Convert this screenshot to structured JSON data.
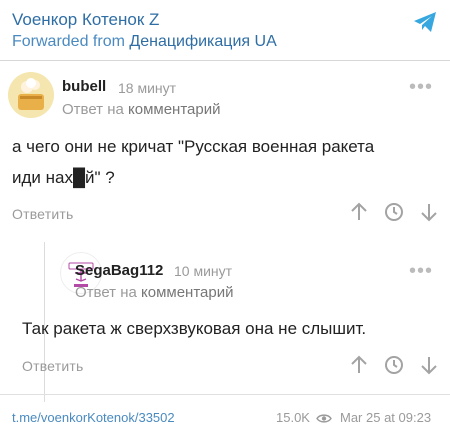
{
  "header": {
    "channel_title": "Voенкор Котенок Z",
    "forwarded_prefix": "Forwarded from ",
    "forwarded_source": "Денацификация UA"
  },
  "comment1": {
    "username": "bubell",
    "time": "18 минут",
    "reply_prefix": "Ответ на ",
    "reply_target": "комментарий",
    "text_line1": "а чего они не кричат \"Русская военная ракета",
    "text_line2": "иди нах█й\" ?",
    "answer_label": "Ответить"
  },
  "comment2": {
    "username": "SegaBag112",
    "time": "10 минут",
    "reply_prefix": "Ответ на ",
    "reply_target": "комментарий",
    "text": "Так ракета ж сверхзвуковая она не слышит.",
    "answer_label": "Ответить"
  },
  "footer": {
    "link": "t.me/voenkorKotenok/33502",
    "views": "15.0K",
    "date": "Mar 25 at 09:23"
  },
  "icons": {
    "telegram": "telegram-plane-icon",
    "more": "more-dots-icon",
    "upvote": "arrow-up-icon",
    "clock": "clock-icon",
    "downvote": "arrow-down-icon",
    "views": "eye-icon"
  },
  "colors": {
    "link_blue": "#2f6ea5",
    "telegram_blue": "#37a7df",
    "muted_gray": "#9a9a9a"
  }
}
